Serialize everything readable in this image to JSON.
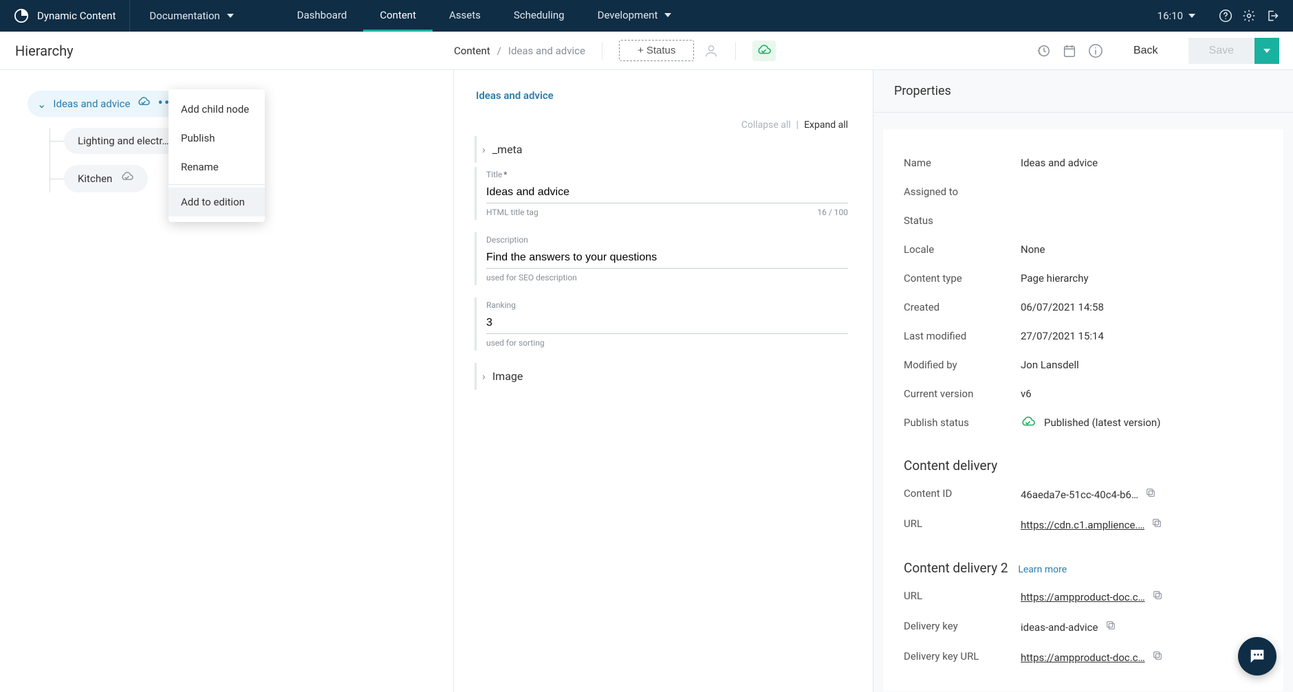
{
  "brand": "Dynamic Content",
  "hub": "Documentation",
  "nav": {
    "items": [
      "Dashboard",
      "Content",
      "Assets",
      "Scheduling",
      "Development"
    ],
    "active": 1
  },
  "clock": "16:10",
  "hierarchy": {
    "title": "Hierarchy",
    "root": "Ideas and advice",
    "children": [
      "Lighting and electr…",
      "Kitchen"
    ]
  },
  "context_menu": {
    "items": [
      "Add child node",
      "Publish",
      "Rename",
      "Add to edition"
    ],
    "highlighted": 3
  },
  "toolbar": {
    "breadcrumb_root": "Content",
    "breadcrumb_leaf": "Ideas and advice",
    "status_label": "+ Status",
    "back": "Back",
    "save": "Save"
  },
  "editor": {
    "title": "Ideas and advice",
    "collapse_all": "Collapse all",
    "expand_all": "Expand all",
    "sections": {
      "meta": "_meta",
      "image": "Image"
    },
    "fields": {
      "title": {
        "label": "Title",
        "required": "*",
        "value": "Ideas and advice",
        "hint": "HTML title tag",
        "count": "16 / 100"
      },
      "description": {
        "label": "Description",
        "value": "Find the answers to your questions",
        "hint": "used for SEO description"
      },
      "ranking": {
        "label": "Ranking",
        "value": "3",
        "hint": "used for sorting"
      }
    }
  },
  "props": {
    "header": "Properties",
    "labels": {
      "name": "Name",
      "assigned_to": "Assigned to",
      "status": "Status",
      "locale": "Locale",
      "content_type": "Content type",
      "created": "Created",
      "last_modified": "Last modified",
      "modified_by": "Modified by",
      "current_version": "Current version",
      "publish_status": "Publish status",
      "content_id": "Content ID",
      "url": "URL",
      "delivery_key": "Delivery key",
      "delivery_key_url": "Delivery key URL"
    },
    "values": {
      "name": "Ideas and advice",
      "assigned_to": "",
      "status": "",
      "locale": "None",
      "content_type": "Page hierarchy",
      "created": "06/07/2021 14:58",
      "last_modified": "27/07/2021 15:14",
      "modified_by": "Jon Lansdell",
      "current_version": "v6",
      "publish_status": "Published (latest version)",
      "content_id": "46aeda7e-51cc-40c4-b6…",
      "url": "https://cdn.c1.amplience.…",
      "delivery_key": "ideas-and-advice",
      "url2": "https://ampproduct-doc.c…",
      "delivery_key_url": "https://ampproduct-doc.c…"
    },
    "sections": {
      "cd": "Content delivery",
      "cd2": "Content delivery 2",
      "learn_more": "Learn more"
    }
  }
}
